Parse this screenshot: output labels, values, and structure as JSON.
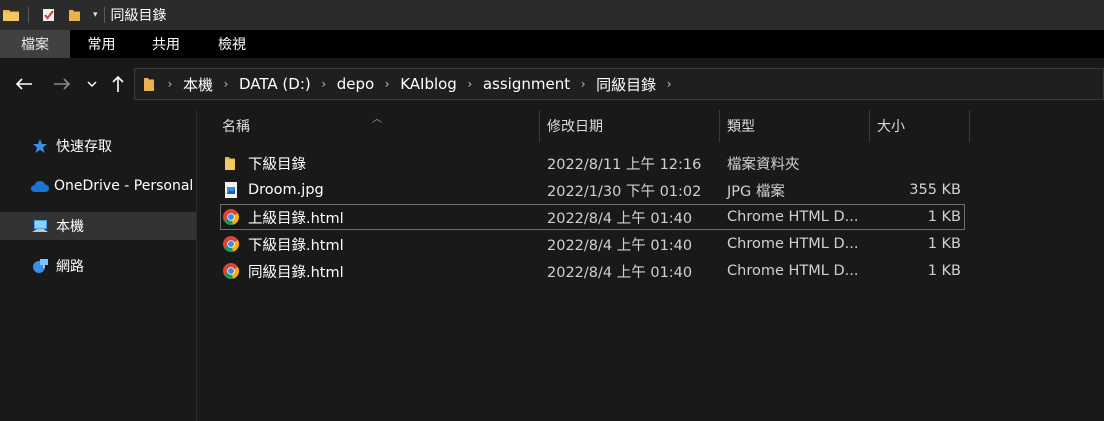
{
  "window": {
    "title": "同級目錄"
  },
  "ribbon": {
    "tabs": [
      "檔案",
      "常用",
      "共用",
      "檢視"
    ]
  },
  "address": {
    "segments": [
      "本機",
      "DATA (D:)",
      "depo",
      "KAIblog",
      "assignment",
      "同級目錄"
    ]
  },
  "sidebar": {
    "items": [
      {
        "label": "快速存取",
        "icon": "star-icon"
      },
      {
        "label": "OneDrive - Personal",
        "icon": "cloud-icon"
      },
      {
        "label": "本機",
        "icon": "computer-icon"
      },
      {
        "label": "網路",
        "icon": "network-icon"
      }
    ]
  },
  "columns": {
    "name": "名稱",
    "date": "修改日期",
    "type": "類型",
    "size": "大小"
  },
  "files": [
    {
      "name": "下級目錄",
      "date": "2022/8/11 上午 12:16",
      "type": "檔案資料夾",
      "size": "",
      "icon": "folder-icon"
    },
    {
      "name": "Droom.jpg",
      "date": "2022/1/30 下午 01:02",
      "type": "JPG 檔案",
      "size": "355 KB",
      "icon": "image-file-icon"
    },
    {
      "name": "上級目錄.html",
      "date": "2022/8/4 上午 01:40",
      "type": "Chrome HTML D...",
      "size": "1 KB",
      "icon": "chrome-icon"
    },
    {
      "name": "下級目錄.html",
      "date": "2022/8/4 上午 01:40",
      "type": "Chrome HTML D...",
      "size": "1 KB",
      "icon": "chrome-icon"
    },
    {
      "name": "同級目錄.html",
      "date": "2022/8/4 上午 01:40",
      "type": "Chrome HTML D...",
      "size": "1 KB",
      "icon": "chrome-icon"
    }
  ],
  "colors": {
    "background": "#191919",
    "titlebar": "#2b2b2b",
    "ribbon": "#000000",
    "active_tab": "#404040",
    "folder": "#e8b34a",
    "selection_border": "#6e6e6e"
  }
}
